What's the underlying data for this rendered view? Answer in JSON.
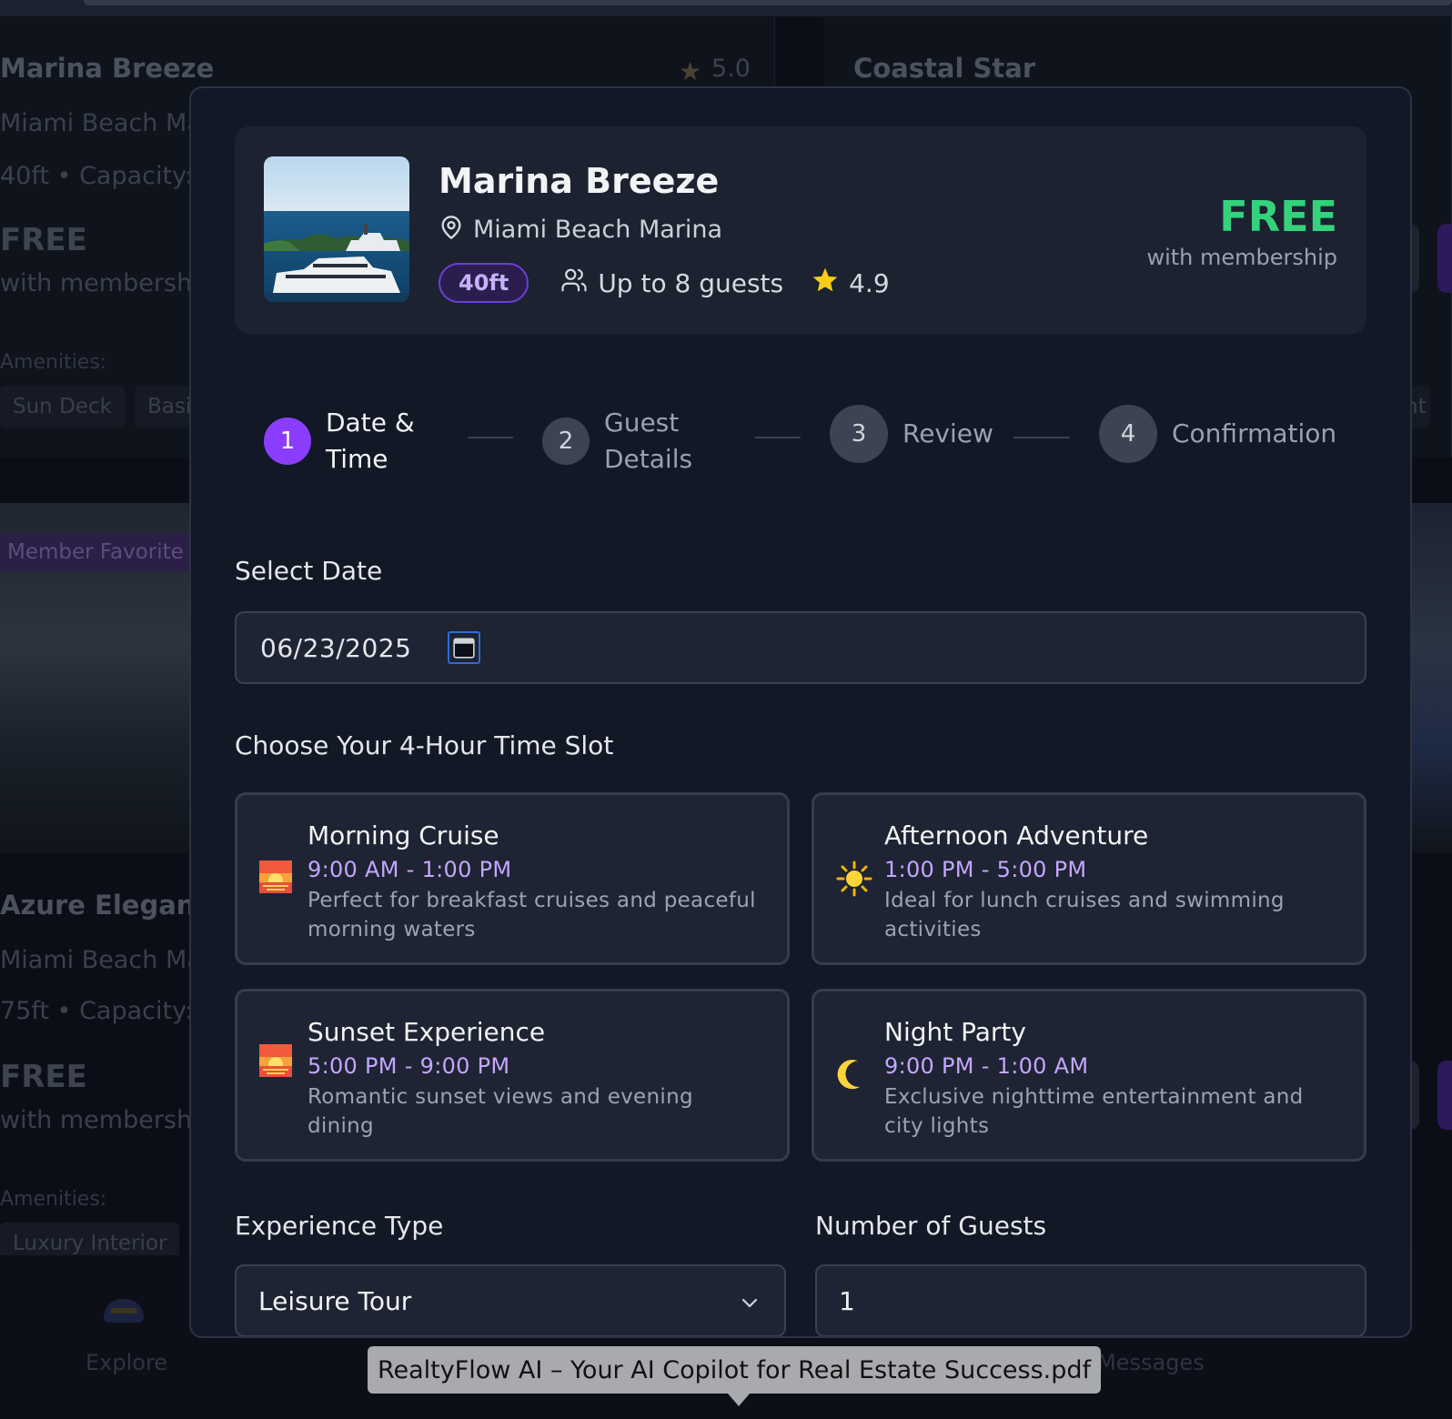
{
  "background": {
    "cards": [
      {
        "title": "Marina Breeze",
        "rating": "5.0",
        "location": "Miami Beach Ma",
        "specs": "40ft • Capacity:",
        "price": "FREE",
        "price_note": "with membershi",
        "amenities_label": "Amenities:",
        "amenities": [
          "Sun Deck",
          "Basi"
        ]
      },
      {
        "title": "Coastal Star",
        "amenity_fragment": "nt"
      },
      {
        "badge": "Member Favorite",
        "title": "Azure Eleganc",
        "location": "Miami Beach Ma",
        "specs": "75ft • Capacity:",
        "price": "FREE",
        "price_note": "with membershi",
        "amenities_label": "Amenities:",
        "amenities": [
          "Luxury Interior"
        ]
      }
    ],
    "nav": {
      "explore_label": "Explore",
      "messages_label": "Messages"
    }
  },
  "modal": {
    "yacht": {
      "name": "Marina Breeze",
      "location": "Miami Beach Marina",
      "length": "40ft",
      "guests": "Up to 8 guests",
      "rating": "4.9",
      "price": "FREE",
      "price_note": "with membership"
    },
    "steps": [
      {
        "number": "1",
        "label": "Date & Time",
        "active": true
      },
      {
        "number": "2",
        "label": "Guest Details",
        "active": false
      },
      {
        "number": "3",
        "label": "Review",
        "active": false
      },
      {
        "number": "4",
        "label": "Confirmation",
        "active": false
      }
    ],
    "date": {
      "label": "Select Date",
      "value": "06/23/2025"
    },
    "time_slots": {
      "label": "Choose Your 4-Hour Time Slot",
      "slots": [
        {
          "icon": "sunrise-icon",
          "title": "Morning Cruise",
          "time": "9:00 AM - 1:00 PM",
          "description": "Perfect for breakfast cruises and peaceful morning waters"
        },
        {
          "icon": "sun-icon",
          "title": "Afternoon Adventure",
          "time": "1:00 PM - 5:00 PM",
          "description": "Ideal for lunch cruises and swimming activities"
        },
        {
          "icon": "sunset-icon",
          "title": "Sunset Experience",
          "time": "5:00 PM - 9:00 PM",
          "description": "Romantic sunset views and evening dining"
        },
        {
          "icon": "crescent-moon-icon",
          "title": "Night Party",
          "time": "9:00 PM - 1:00 AM",
          "description": "Exclusive nighttime entertainment and city lights"
        }
      ]
    },
    "experience": {
      "label": "Experience Type",
      "value": "Leisure Tour"
    },
    "guests_field": {
      "label": "Number of Guests",
      "value": "1"
    }
  },
  "tooltip": {
    "text": "RealtyFlow AI – Your AI Copilot for Real Estate Success.pdf"
  },
  "colors": {
    "accent": "#8b3dff",
    "price_green": "#34d37b",
    "time_purple": "#c4a6ff"
  }
}
